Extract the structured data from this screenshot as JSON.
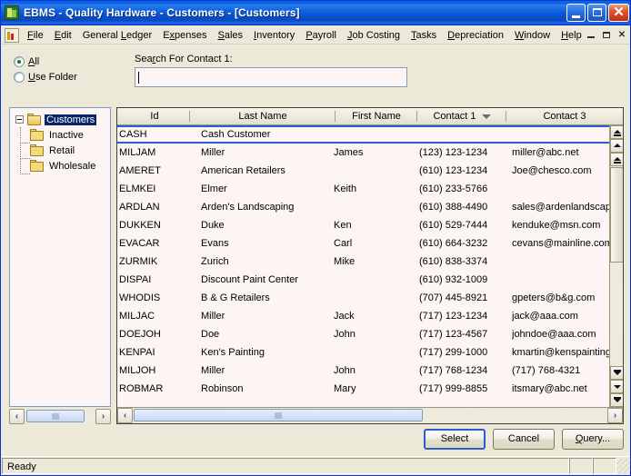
{
  "window": {
    "title": "EBMS  -  Quality Hardware  -  Customers  -  [Customers]",
    "app_icon": "ebms-app-icon",
    "minimize_label": "",
    "maximize_label": "",
    "close_label": "✕"
  },
  "menubar": {
    "items": [
      {
        "label": "File",
        "accel": "F"
      },
      {
        "label": "Edit",
        "accel": "E"
      },
      {
        "label": "General Ledger",
        "accel": "L"
      },
      {
        "label": "Expenses",
        "accel": "x"
      },
      {
        "label": "Sales",
        "accel": "S"
      },
      {
        "label": "Inventory",
        "accel": "I"
      },
      {
        "label": "Payroll",
        "accel": "P"
      },
      {
        "label": "Job Costing",
        "accel": "J"
      },
      {
        "label": "Tasks",
        "accel": "T"
      },
      {
        "label": "Depreciation",
        "accel": "D"
      },
      {
        "label": "Window",
        "accel": "W"
      },
      {
        "label": "Help",
        "accel": "H"
      }
    ],
    "mdi": {
      "minimize": "",
      "restore": "",
      "close": "✕"
    }
  },
  "search": {
    "label": "Search For Contact 1:",
    "value": "",
    "placeholder": "",
    "radio_all": "All",
    "radio_use_folder": "Use Folder",
    "selected": "All"
  },
  "tree": {
    "root": {
      "label": "Customers",
      "selected": true,
      "expanded": true
    },
    "children": [
      {
        "label": "Inactive"
      },
      {
        "label": "Retail"
      },
      {
        "label": "Wholesale"
      }
    ]
  },
  "grid": {
    "columns": [
      {
        "label": "Id",
        "sorted": false
      },
      {
        "label": "Last Name",
        "sorted": false
      },
      {
        "label": "First Name",
        "sorted": false
      },
      {
        "label": "Contact 1",
        "sorted": true
      },
      {
        "label": "Contact 3",
        "sorted": false
      }
    ],
    "rows": [
      {
        "id": "CASH",
        "last": "Cash Customer",
        "first": "",
        "c1": "",
        "c3": "",
        "current": true
      },
      {
        "id": "MILJAM",
        "last": "Miller",
        "first": "James",
        "c1": "(123) 123-1234",
        "c3": "miller@abc.net"
      },
      {
        "id": "AMERET",
        "last": "American Retailers",
        "first": "",
        "c1": "(610) 123-1234",
        "c3": "Joe@chesco.com"
      },
      {
        "id": "ELMKEI",
        "last": "Elmer",
        "first": "Keith",
        "c1": "(610) 233-5766",
        "c3": ""
      },
      {
        "id": "ARDLAN",
        "last": "Arden's Landscaping",
        "first": "",
        "c1": "(610) 388-4490",
        "c3": "sales@ardenlandscaping.com"
      },
      {
        "id": "DUKKEN",
        "last": "Duke",
        "first": "Ken",
        "c1": "(610) 529-7444",
        "c3": "kenduke@msn.com"
      },
      {
        "id": "EVACAR",
        "last": "Evans",
        "first": "Carl",
        "c1": "(610) 664-3232",
        "c3": "cevans@mainline.com"
      },
      {
        "id": "ZURMIK",
        "last": "Zurich",
        "first": "Mike",
        "c1": "(610) 838-3374",
        "c3": ""
      },
      {
        "id": "DISPAI",
        "last": "Discount Paint Center",
        "first": "",
        "c1": "(610) 932-1009",
        "c3": ""
      },
      {
        "id": "WHODIS",
        "last": "B & G Retailers",
        "first": "",
        "c1": "(707) 445-8921",
        "c3": "gpeters@b&g.com"
      },
      {
        "id": "MILJAC",
        "last": "Miller",
        "first": "Jack",
        "c1": "(717) 123-1234",
        "c3": "jack@aaa.com"
      },
      {
        "id": "DOEJOH",
        "last": "Doe",
        "first": "John",
        "c1": "(717) 123-4567",
        "c3": "johndoe@aaa.com"
      },
      {
        "id": "KENPAI",
        "last": "Ken's Painting",
        "first": "",
        "c1": "(717) 299-1000",
        "c3": "kmartin@kenspainting.net"
      },
      {
        "id": "MILJOH",
        "last": "Miller",
        "first": "John",
        "c1": "(717) 768-1234",
        "c3": "(717) 768-4321"
      },
      {
        "id": "ROBMAR",
        "last": "Robinson",
        "first": "Mary",
        "c1": "(717) 999-8855",
        "c3": "itsmary@abc.net"
      }
    ]
  },
  "buttons": {
    "select": "Select",
    "cancel": "Cancel",
    "query": "Query..."
  },
  "statusbar": {
    "message": "Ready"
  },
  "scrollbars": {
    "left_arrow": "‹",
    "right_arrow": "›"
  },
  "colors": {
    "titlebar_blue": "#0b5ddb",
    "selection_blue": "#0a246a",
    "grid_background": "#fdf4f4",
    "face": "#ece9d8",
    "current_row_border": "#2a5fd0"
  }
}
